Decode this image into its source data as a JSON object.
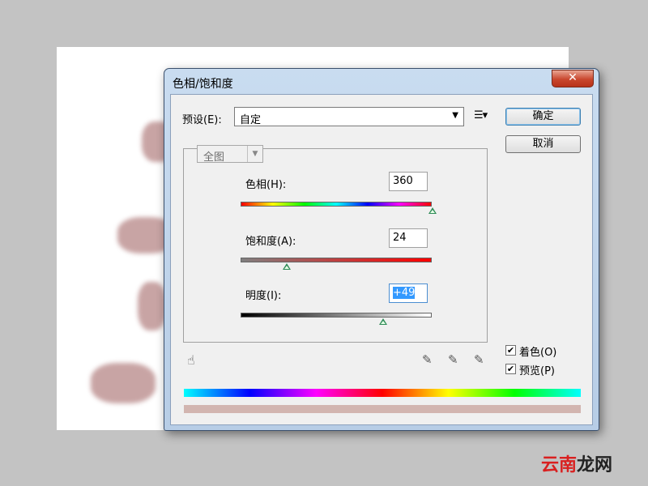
{
  "dialog": {
    "title": "色相/饱和度",
    "close_label": "✕"
  },
  "preset": {
    "label": "预设(E):",
    "value": "自定",
    "menu_icon": "list-options-icon"
  },
  "buttons": {
    "ok": "确定",
    "cancel": "取消"
  },
  "channel": {
    "value": "全图"
  },
  "sliders": {
    "hue": {
      "label": "色相(H):",
      "value": "360"
    },
    "saturation": {
      "label": "饱和度(A):",
      "value": "24"
    },
    "lightness": {
      "label": "明度(I):",
      "value": "+49"
    }
  },
  "options": {
    "colorize": {
      "label": "着色(O)",
      "checked": true
    },
    "preview": {
      "label": "预览(P)",
      "checked": true
    }
  },
  "icons": [
    "hand-adjust-icon",
    "eyedropper-icon",
    "eyedropper-plus-icon",
    "eyedropper-minus-icon"
  ],
  "watermark": {
    "part1": "云南",
    "part2": "龙网"
  },
  "colors": {
    "dialog_frame": "#b7cde6",
    "close_button": "#c9472e",
    "selection": "#3399ff",
    "result_bar": "#d2b5b0"
  }
}
